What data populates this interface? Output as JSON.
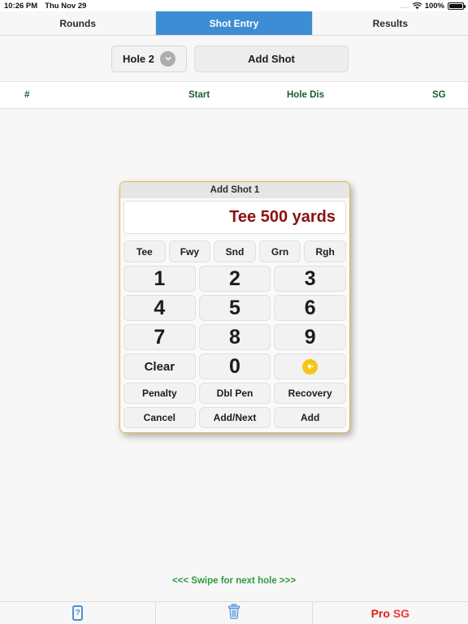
{
  "statusbar": {
    "time": "10:26 PM",
    "date": "Thu Nov 29",
    "dots": "....",
    "wifi_icon": "wifi-icon",
    "battery_percent": "100%",
    "battery_icon": "battery-icon"
  },
  "tabs": [
    {
      "label": "Rounds",
      "active": false
    },
    {
      "label": "Shot Entry",
      "active": true
    },
    {
      "label": "Results",
      "active": false
    }
  ],
  "toolbar": {
    "hole_label": "Hole 2",
    "hole_chevron_icon": "chevron-down-icon",
    "add_shot_label": "Add Shot"
  },
  "table": {
    "headers": [
      "#",
      "Start",
      "Hole Dis",
      "SG"
    ],
    "rows": []
  },
  "dialog": {
    "title": "Add Shot 1",
    "display_value": "Tee 500 yards",
    "lie_buttons": [
      "Tee",
      "Fwy",
      "Snd",
      "Grn",
      "Rgh"
    ],
    "keypad": [
      [
        "1",
        "2",
        "3"
      ],
      [
        "4",
        "5",
        "6"
      ],
      [
        "7",
        "8",
        "9"
      ]
    ],
    "clear_label": "Clear",
    "zero_label": "0",
    "backspace_icon": "backspace-arrow-icon",
    "action_buttons": [
      "Penalty",
      "Dbl Pen",
      "Recovery"
    ],
    "footer_buttons": [
      "Cancel",
      "Add/Next",
      "Add"
    ]
  },
  "swipe_hint": "<<< Swipe for next hole >>>",
  "bottom_bar": {
    "help_icon": "help-question-icon",
    "help_label": "?",
    "trash_icon": "trash-icon",
    "pro_sg_part1": "Pro",
    "pro_sg_part2": "SG"
  },
  "colors": {
    "tab_active": "#3d8dd4",
    "dialog_border": "#e2b84d",
    "display_text": "#8c1111",
    "table_header": "#1d5c2e",
    "swipe_hint": "#2e9b3e",
    "backspace_circle": "#f5c518",
    "pro_sg": "#e02020",
    "icon_blue": "#4a90d9"
  }
}
